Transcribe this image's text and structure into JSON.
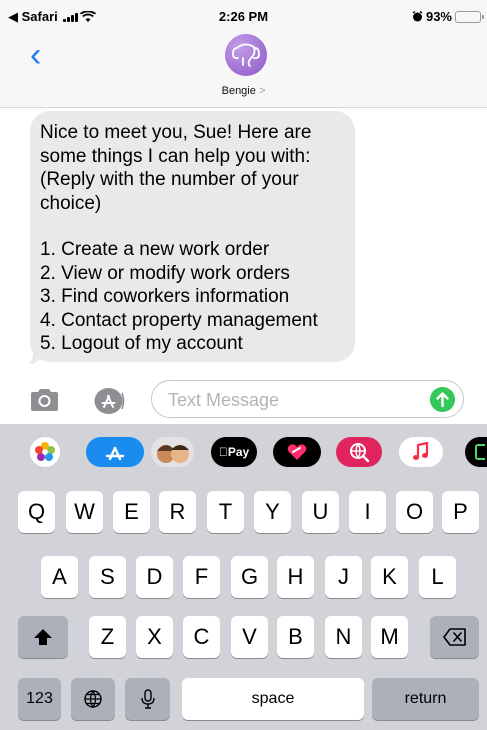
{
  "status_bar": {
    "back_app": "◀ Safari",
    "time": "2:26 PM",
    "battery_text": "93%",
    "battery_level": 0.93
  },
  "header": {
    "back_label": "‹",
    "contact_name": "Bengie",
    "contact_chevron": ">"
  },
  "conversation": {
    "message_lines": [
      "Nice to meet you, Sue! Here are",
      "some things I can help you with:",
      "(Reply with the number of your",
      "choice)"
    ],
    "options": [
      "1. Create a new work order",
      "2. View or modify work orders",
      "3. Find coworkers information",
      "4. Contact property management",
      "5. Logout of my account"
    ]
  },
  "compose": {
    "placeholder": "Text Message",
    "value": ""
  },
  "app_strip": {
    "apple_pay_label": "Pay"
  },
  "keyboard": {
    "row1": [
      "Q",
      "W",
      "E",
      "R",
      "T",
      "Y",
      "U",
      "I",
      "O",
      "P"
    ],
    "row2": [
      "A",
      "S",
      "D",
      "F",
      "G",
      "H",
      "J",
      "K",
      "L"
    ],
    "row3": [
      "Z",
      "X",
      "C",
      "V",
      "B",
      "N",
      "M"
    ],
    "numbers_label": "123",
    "space_label": "space",
    "return_label": "return"
  },
  "colors": {
    "ios_blue": "#1a7cf5",
    "bubble_gray": "#e9e9eb",
    "send_green": "#34c759",
    "keyboard_bg": "#d1d3d8"
  }
}
